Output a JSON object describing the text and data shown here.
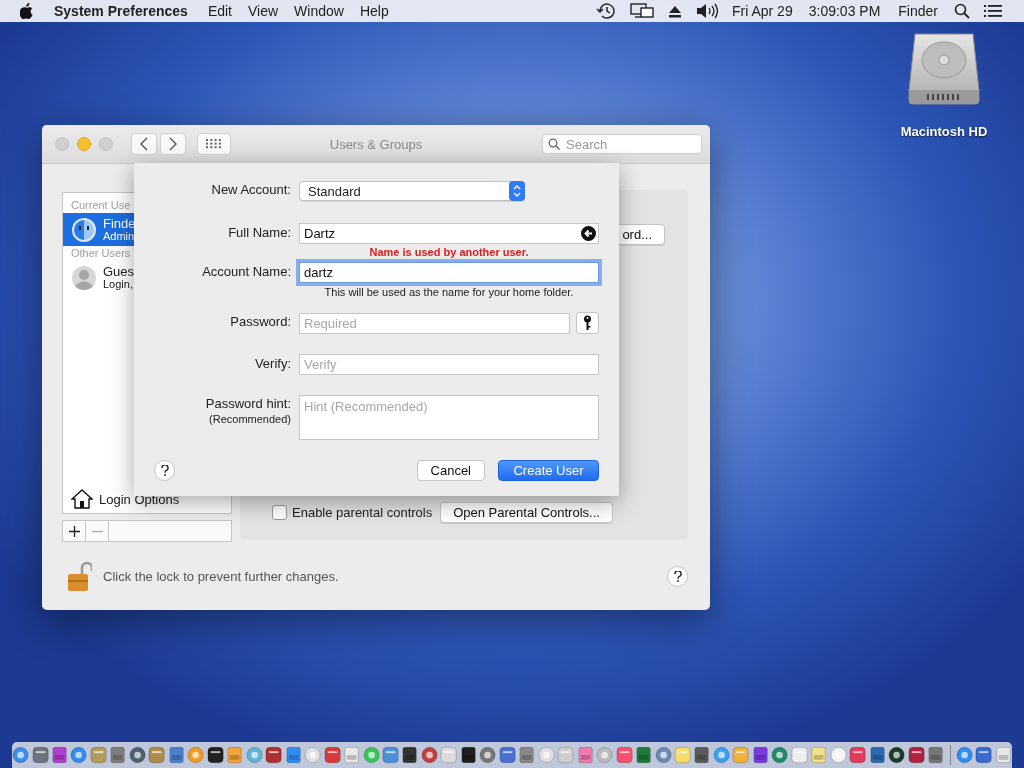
{
  "menu_bar": {
    "app": "System Preferences",
    "menus": [
      "Edit",
      "View",
      "Window",
      "Help"
    ],
    "date": "Fri Apr 29",
    "time": "3:09:03 PM",
    "user": "Finder"
  },
  "desktop_icons": [
    {
      "label": "Macintosh HD"
    }
  ],
  "window": {
    "title": "Users & Groups",
    "search": {
      "placeholder": "Search"
    },
    "sidebar": {
      "sections": [
        {
          "header": "Current Use",
          "users": [
            {
              "name": "Finde",
              "role": "Admin",
              "selected": true,
              "kind": "admin"
            }
          ]
        },
        {
          "header": "Other Users",
          "users": [
            {
              "name": "Gues",
              "role": "Login,",
              "selected": false,
              "kind": "guest"
            }
          ]
        }
      ],
      "login_options": "Login Options"
    },
    "change_password_button": "ord...",
    "parental_checkbox": {
      "label": "Enable parental controls",
      "checked": false
    },
    "parental_button": "Open Parental Controls...",
    "lock_text": "Click the lock to prevent further changes.",
    "locked": false
  },
  "sheet": {
    "rows": [
      {
        "kind": "popup",
        "label": "New Account:",
        "value": "Standard"
      },
      {
        "kind": "name",
        "label": "Full Name:",
        "value": "Dartz",
        "focused": false,
        "error": "Name is used by another user."
      },
      {
        "kind": "text",
        "label": "Account Name:",
        "value": "dartz",
        "focused": true,
        "note": "This will be used as the name for your home folder."
      },
      {
        "kind": "password",
        "label": "Password:",
        "placeholder": "Required",
        "focused": false
      },
      {
        "kind": "text",
        "label": "Verify:",
        "placeholder": "Verify",
        "focused": false
      },
      {
        "kind": "textarea",
        "label": "Password hint:",
        "sublabel": "(Recommended)",
        "placeholder": "Hint (Recommended)",
        "focused": false
      }
    ],
    "buttons": [
      {
        "label": "Cancel",
        "default": false
      },
      {
        "label": "Create User",
        "default": true
      }
    ]
  }
}
